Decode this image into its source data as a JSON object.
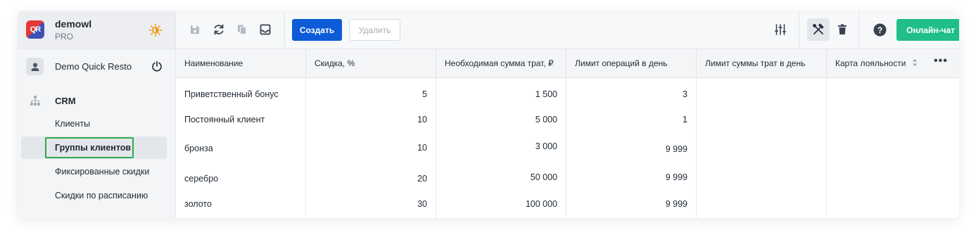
{
  "brand": {
    "logo_text": "QR",
    "name": "demowl",
    "plan": "PRO"
  },
  "user": {
    "name": "Demo Quick Resto"
  },
  "nav": {
    "section": "CRM",
    "items": [
      {
        "label": "Клиенты",
        "active": false
      },
      {
        "label": "Группы клиентов",
        "active": true
      },
      {
        "label": "Фиксированные скидки",
        "active": false
      },
      {
        "label": "Скидки по расписанию",
        "active": false
      }
    ]
  },
  "toolbar": {
    "create_label": "Создать",
    "delete_label": "Удалить",
    "chat_label": "Онлайн-чат",
    "icons": [
      "save-icon",
      "refresh-icon",
      "copy-icon",
      "inbox-icon",
      "columns-settings-icon",
      "tools-icon",
      "trash-icon",
      "help-icon"
    ]
  },
  "colors": {
    "primary": "#0d5bd7",
    "chat": "#20bf8a",
    "highlight": "#2eaa4a",
    "sun": "#f0a020"
  },
  "table": {
    "columns": [
      "Наименование",
      "Скидка, %",
      "Необходимая сумма трат, ₽",
      "Лимит операций в день",
      "Лимит суммы трат в день",
      "Карта лояльности"
    ],
    "rows": [
      [
        "Приветственный бонус",
        "5",
        "1 500",
        "3",
        "",
        ""
      ],
      [
        "Постоянный клиент",
        "10",
        "5 000",
        "1",
        "",
        ""
      ],
      [
        "бронза",
        "10",
        "3 000",
        "9 999",
        "",
        ""
      ],
      [
        "серебро",
        "20",
        "50 000",
        "9 999",
        "",
        ""
      ],
      [
        "золото",
        "30",
        "100 000",
        "9 999",
        "",
        ""
      ]
    ]
  }
}
